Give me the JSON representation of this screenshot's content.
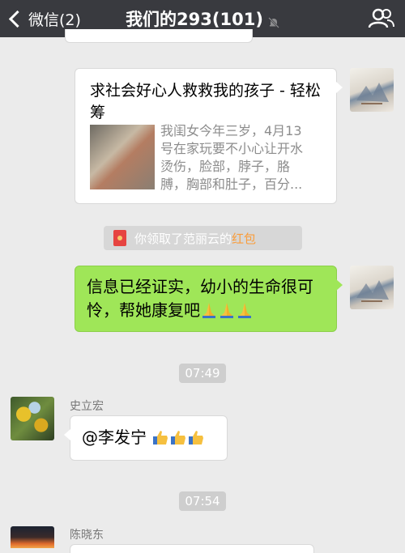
{
  "header": {
    "back_label": "微信(2)",
    "title": "我们的293(101)",
    "mute_icon": "bell-off-icon",
    "people_icon": "group-icon"
  },
  "messages": {
    "link_card": {
      "title": "求社会好心人救救我的孩子 - 轻松筹",
      "description": "我闺女今年三岁，4月13号在家玩要不小心让开水烫伤，脸部，脖子，胳膊，胸部和肚子，百分..."
    },
    "system_redpacket": {
      "prefix": "你领取了范丽云的",
      "highlight": "红包",
      "highlight_color": "#fa9d3b"
    },
    "green_message": {
      "text": "信息已经证实，幼小的生命很可怜，帮她康复吧"
    },
    "time_1": "07:49",
    "shi": {
      "sender": "史立宏",
      "text": "@李发宁"
    },
    "time_2": "07:54",
    "chen": {
      "sender": "陈晓东"
    }
  },
  "colors": {
    "nav_bg": "#393a3f",
    "self_bubble": "#9fe658",
    "chat_bg": "#ebebeb"
  }
}
